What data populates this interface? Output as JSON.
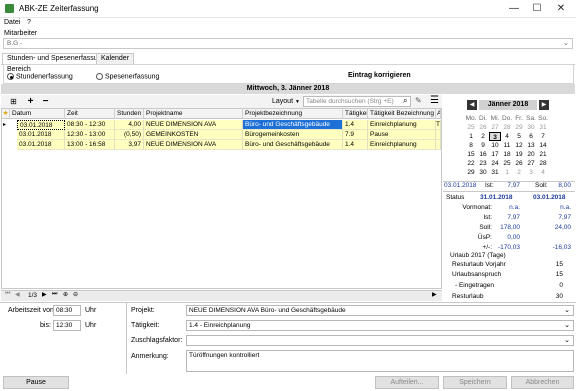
{
  "window": {
    "title": "ABK-ZE Zeiterfassung",
    "minimize": "—",
    "maximize": "☐",
    "close": "✕"
  },
  "menu": {
    "file": "Datei",
    "help": "?"
  },
  "employee": {
    "label": "Mitarbeiter",
    "value": "B.G -"
  },
  "tabs": [
    {
      "label": "Stunden- und Spesenerfassung"
    },
    {
      "label": "Kalender"
    }
  ],
  "area": {
    "label": "Bereich",
    "opt1": "Stundenerfassung",
    "opt2": "Spesenerfassung",
    "edit_title": "Eintrag korrigieren"
  },
  "date_header": "Mittwoch, 3. Jänner 2018",
  "toolbar": {
    "layout": "Layout",
    "search_placeholder": "Tabelle durchsuchen (Strg +E)"
  },
  "columns": [
    "Datum",
    "Zeit",
    "Stunden",
    "Projektname",
    "Projektbezeichnung",
    "Tätigkeit",
    "Tätigkeit Bezeichnung",
    "Ar"
  ],
  "rows": [
    {
      "date": "03.01.2018",
      "time": "08:30 - 12:30",
      "hours": "4,00",
      "project": "NEUE DIMENSION AVA",
      "desc": "Büro- und Geschäftsgebäude",
      "act": "1.4",
      "act_desc": "Einreichplanung",
      "ar": "Tü"
    },
    {
      "date": "03.01.2018",
      "time": "12:30 - 13:00",
      "hours": "(0,50)",
      "project": "GEMEINKOSTEN",
      "desc": "Bürogemeinkosten",
      "act": "7.9",
      "act_desc": "Pause",
      "ar": ""
    },
    {
      "date": "03.01.2018",
      "time": "13:00 - 16:58",
      "hours": "3,97",
      "project": "NEUE DIMENSION AVA",
      "desc": "Büro- und Geschäftsgebäude",
      "act": "1.4",
      "act_desc": "Einreichplanung",
      "ar": ""
    }
  ],
  "pager": {
    "page": "1/3"
  },
  "calendar": {
    "month": "Jänner 2018",
    "weekdays": [
      "Mo.",
      "Di.",
      "Mi.",
      "Do.",
      "Fr.",
      "Sa.",
      "So."
    ],
    "weeks": [
      [
        "25",
        "26",
        "27",
        "28",
        "29",
        "30",
        "31"
      ],
      [
        "1",
        "2",
        "3",
        "4",
        "5",
        "6",
        "7"
      ],
      [
        "8",
        "9",
        "10",
        "11",
        "12",
        "13",
        "14"
      ],
      [
        "15",
        "16",
        "17",
        "18",
        "19",
        "20",
        "21"
      ],
      [
        "22",
        "23",
        "24",
        "25",
        "26",
        "27",
        "28"
      ],
      [
        "29",
        "30",
        "31",
        "1",
        "2",
        "3",
        "4"
      ]
    ]
  },
  "stats": {
    "date": "03.01.2018",
    "ist_label": "Ist:",
    "ist": "7,97",
    "soll_label": "Soll:",
    "soll": "8,00",
    "status_label": "Status",
    "status_d1": "31.01.2018",
    "status_d2": "03.01.2018",
    "lines": [
      {
        "label": "Vormonat:",
        "v1": "n.a.",
        "v2": "n.a."
      },
      {
        "label": "Ist:",
        "v1": "7,97",
        "v2": "7,97"
      },
      {
        "label": "Soll:",
        "v1": "178,00",
        "v2": "24,00"
      },
      {
        "label": "ÜsP:",
        "v1": "0,00",
        "v2": ""
      },
      {
        "label": "+/-:",
        "v1": "-170,03",
        "v2": "-16,03"
      }
    ],
    "vacation_title": "Urlaub 2017 (Tage)",
    "vacation": [
      {
        "label": "Resturlaub Vorjahr",
        "v": "15"
      },
      {
        "label": "Urlaubsanspruch",
        "v": "15"
      },
      {
        "label": "- Eingetragen",
        "v": "0"
      },
      {
        "label": "Resturlaub",
        "v": "30"
      }
    ]
  },
  "form": {
    "from_label": "Arbeitszeit von:",
    "from": "08:30",
    "to_label": "bis:",
    "to": "12:30",
    "unit": "Uhr",
    "project_label": "Projekt:",
    "project": "NEUE DIMENSION AVA  Büro- und Geschäftsgebäude",
    "activity_label": "Tätigkeit:",
    "activity": "1.4 - Einreichplanung",
    "factor_label": "Zuschlagsfaktor:",
    "factor": "",
    "note_label": "Anmerkung:",
    "note": "Türöffnungen kontrolliert"
  },
  "buttons": {
    "pause": "Pause",
    "split": "Aufteilen...",
    "save": "Speichern",
    "cancel": "Abbrechen"
  }
}
